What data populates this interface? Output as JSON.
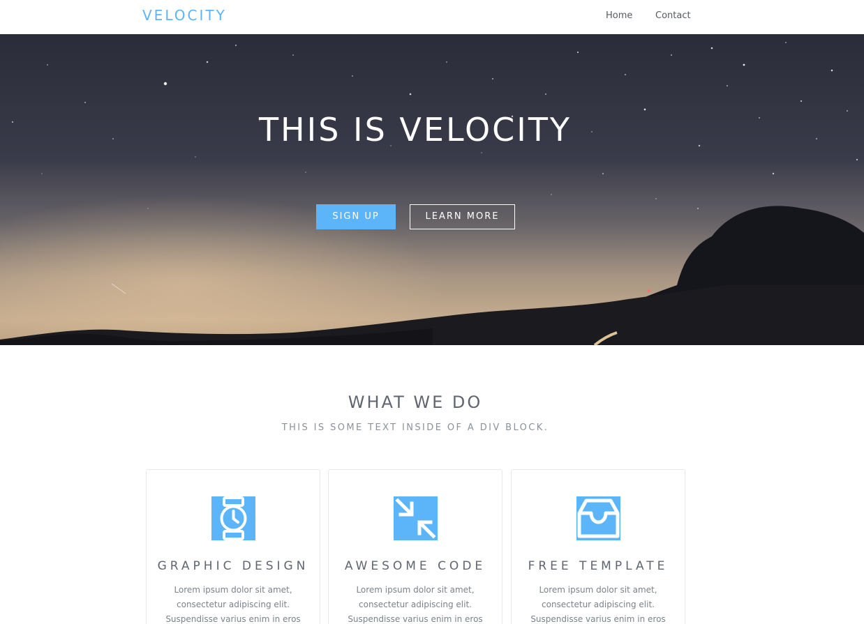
{
  "nav": {
    "brand": "VELOCITY",
    "links": [
      "Home",
      "Contact"
    ]
  },
  "hero": {
    "title": "THIS IS VELOCITY",
    "signup_label": "SIGN UP",
    "learn_more_label": "LEARN MORE"
  },
  "section": {
    "title": "WHAT WE DO",
    "subtitle": "THIS IS SOME TEXT INSIDE OF A DIV BLOCK."
  },
  "cards": [
    {
      "icon": "watch-icon",
      "title": "GRAPHIC DESIGN",
      "text": "Lorem ipsum dolor sit amet, consectetur adipiscing elit. Suspendisse varius enim in eros elementum tristique."
    },
    {
      "icon": "compress-arrows-icon",
      "title": "AWESOME CODE",
      "text": "Lorem ipsum dolor sit amet, consectetur adipiscing elit. Suspendisse varius enim in eros elementum tristique."
    },
    {
      "icon": "inbox-tray-icon",
      "title": "FREE TEMPLATE",
      "text": "Lorem ipsum dolor sit amet, consectetur adipiscing elit. Suspendisse varius enim in eros elementum tristique."
    }
  ],
  "colors": {
    "accent": "#5cb5f8",
    "text": "#5f6670",
    "muted": "#8a919a"
  }
}
